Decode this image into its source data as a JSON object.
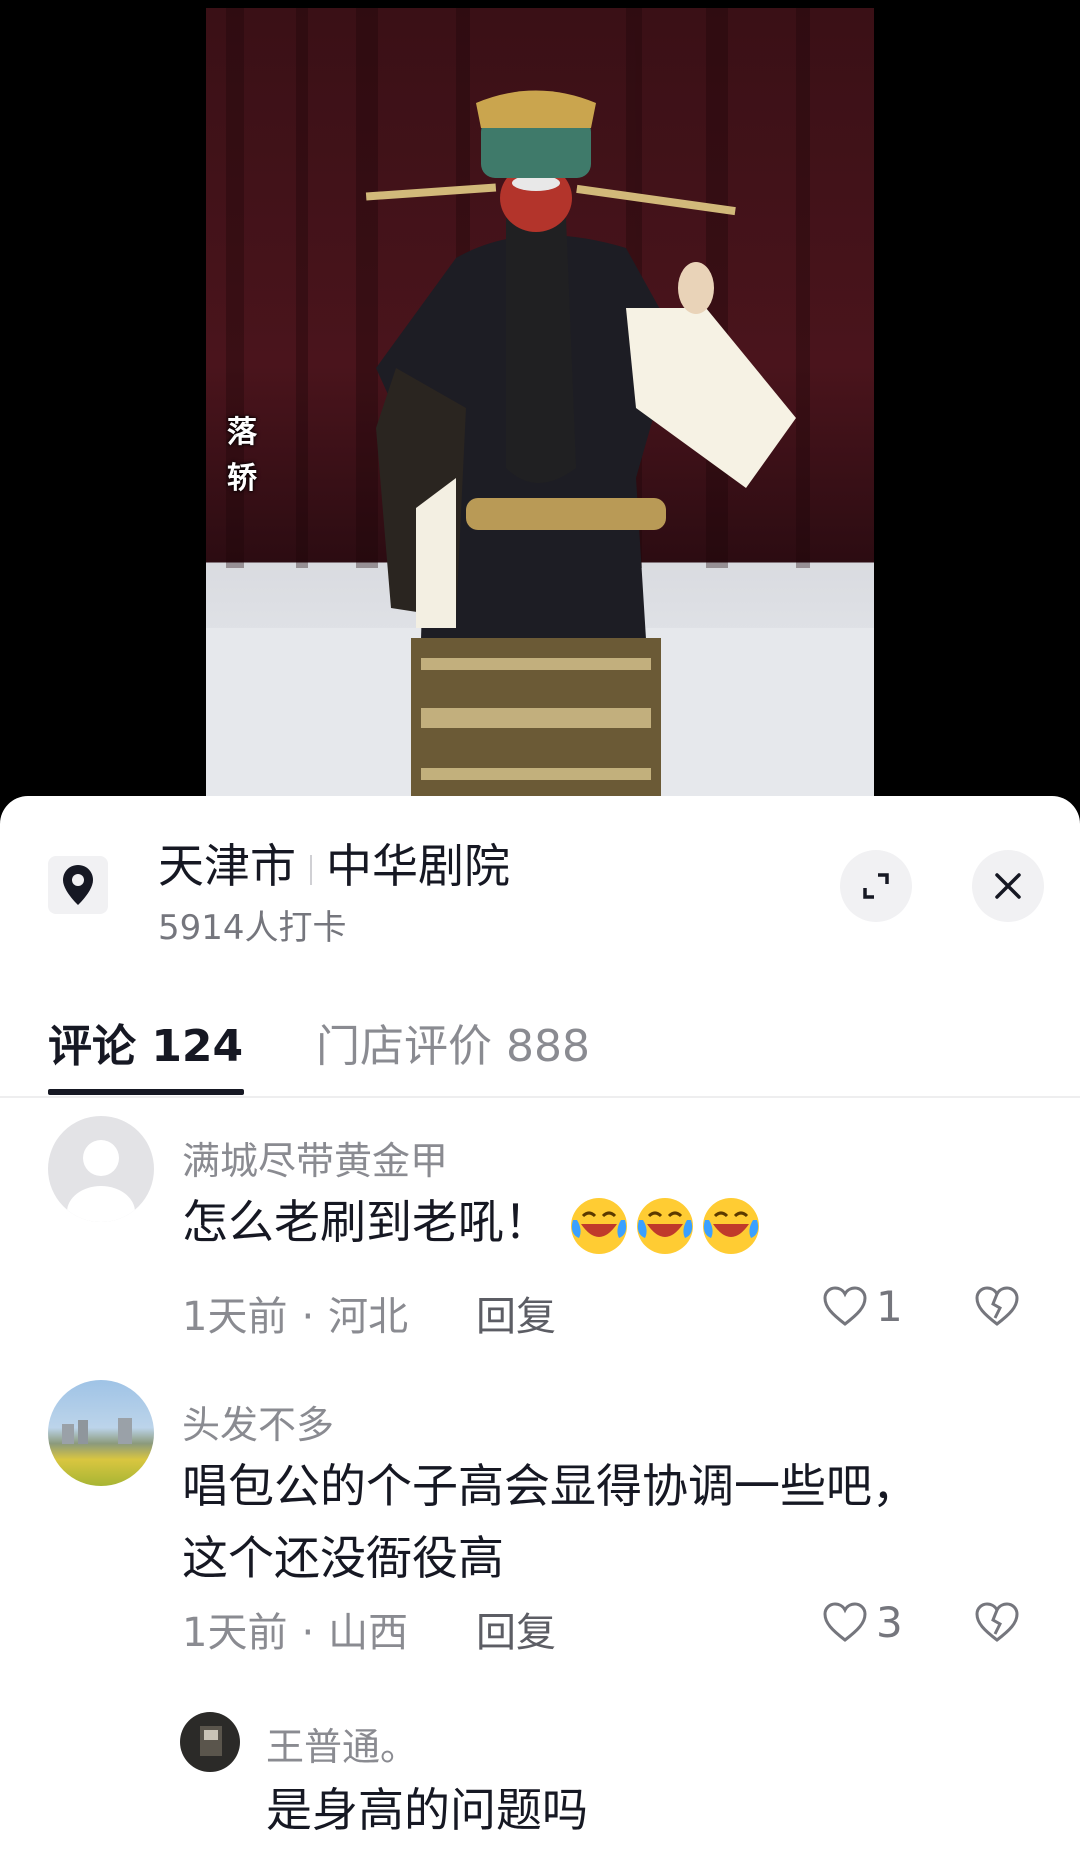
{
  "video": {
    "subtitle": "落\n轿"
  },
  "location": {
    "city": "天津市",
    "venue": "中华剧院",
    "checkins": "5914人打卡"
  },
  "tabs": [
    {
      "label": "评论 124",
      "active": true
    },
    {
      "label": "门店评价 888",
      "active": false
    }
  ],
  "comments": [
    {
      "user": "满城尽带黄金甲",
      "text": "怎么老刷到老吼！",
      "emoji_count": 3,
      "time": "1天前",
      "region": "河北",
      "reply_label": "回复",
      "likes": "1"
    },
    {
      "user": "头发不多",
      "text": "唱包公的个子高会显得协调一些吧，\n这个还没衙役高",
      "time": "1天前",
      "region": "山西",
      "reply_label": "回复",
      "likes": "3"
    }
  ],
  "reply": {
    "user": "王普通。",
    "text": "是身高的问题吗"
  },
  "icons": {
    "location": "map-pin-icon",
    "expand": "expand-icon",
    "close": "close-icon",
    "like": "heart-outline-icon",
    "dislike": "broken-heart-icon",
    "emoji": "laughing-crying-emoji"
  },
  "colors": {
    "text_primary": "#161823",
    "text_secondary": "#8a8b91",
    "sheet_bg": "#ffffff"
  }
}
